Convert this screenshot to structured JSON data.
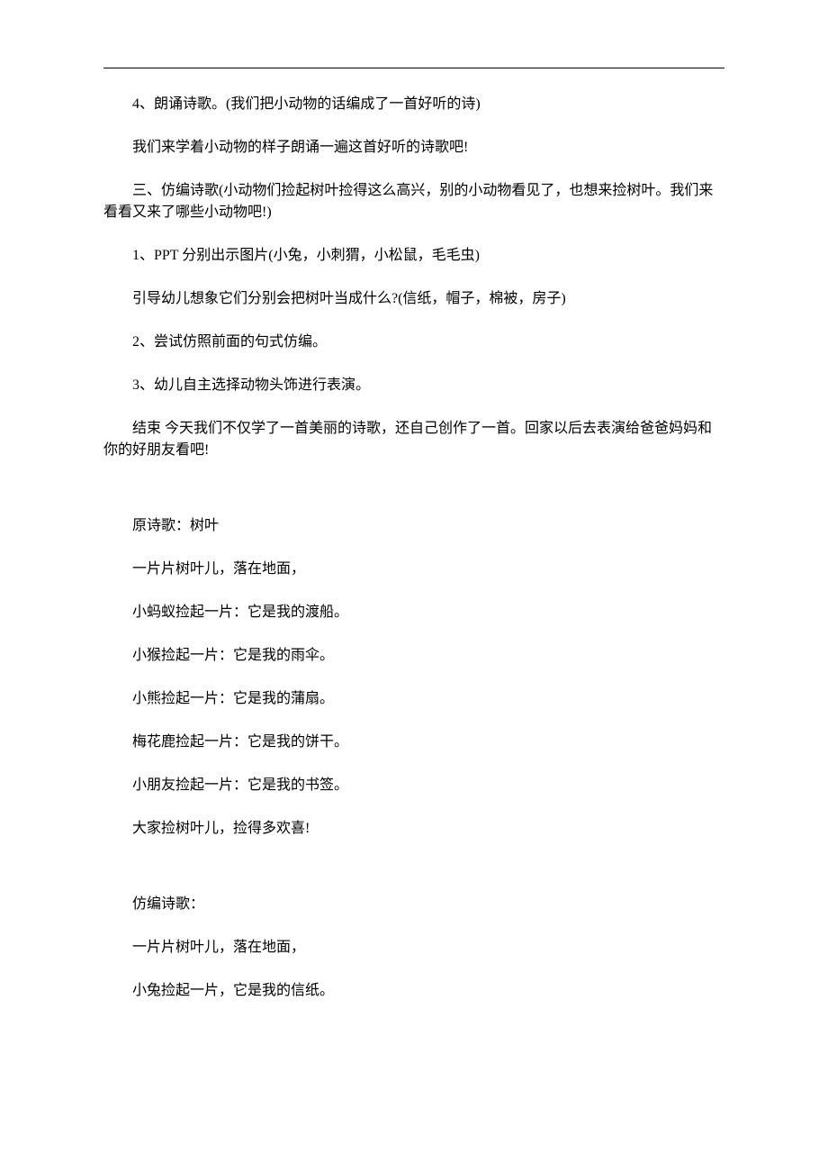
{
  "p1": "4、朗诵诗歌。(我们把小动物的话编成了一首好听的诗)",
  "p2": "我们来学着小动物的样子朗诵一遍这首好听的诗歌吧!",
  "p3": "三、仿编诗歌(小动物们捡起树叶捡得这么高兴，别的小动物看见了，也想来捡树叶。我们来看看又来了哪些小动物吧!)",
  "p4": "1、PPT 分别出示图片(小兔，小刺猬，小松鼠，毛毛虫)",
  "p5": "引导幼儿想象它们分别会把树叶当成什么?(信纸，帽子，棉被，房子)",
  "p6": "2、尝试仿照前面的句式仿编。",
  "p7": "3、幼儿自主选择动物头饰进行表演。",
  "p8": "结束 今天我们不仅学了一首美丽的诗歌，还自己创作了一首。回家以后去表演给爸爸妈妈和你的好朋友看吧!",
  "p9": "原诗歌：树叶",
  "p10": "一片片树叶儿，落在地面，",
  "p11": "小蚂蚁捡起一片：它是我的渡船。",
  "p12": "小猴捡起一片：它是我的雨伞。",
  "p13": "小熊捡起一片：它是我的蒲扇。",
  "p14": "梅花鹿捡起一片：它是我的饼干。",
  "p15": "小朋友捡起一片：它是我的书签。",
  "p16": "大家捡树叶儿，捡得多欢喜!",
  "p17": "仿编诗歌：",
  "p18": "一片片树叶儿，落在地面，",
  "p19": "小兔捡起一片，它是我的信纸。"
}
